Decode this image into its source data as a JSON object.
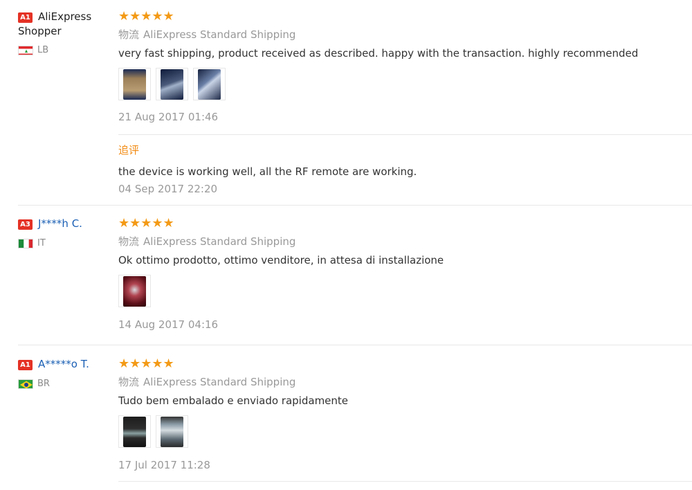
{
  "reviews": [
    {
      "badge": "A1",
      "user": "AliExpress Shopper",
      "user_is_link": false,
      "country": "LB",
      "stars": "★★★★★",
      "shipping_label": "物流",
      "shipping_method": "AliExpress Standard Shipping",
      "text": "very fast shipping, product received as described. happy with the transaction. highly recommended",
      "photos": 3,
      "date": "21 Aug 2017 01:46",
      "followup": {
        "label": "追评",
        "text": "the device is working well, all the RF remote are working.",
        "date": "04 Sep 2017 22:20"
      }
    },
    {
      "badge": "A3",
      "user": "J****h C.",
      "user_is_link": true,
      "country": "IT",
      "stars": "★★★★★",
      "shipping_label": "物流",
      "shipping_method": "AliExpress Standard Shipping",
      "text": "Ok ottimo prodotto, ottimo venditore, in attesa di installazione",
      "photos": 1,
      "date": "14 Aug 2017 04:16"
    },
    {
      "badge": "A1",
      "user": "A*****o T.",
      "user_is_link": true,
      "country": "BR",
      "stars": "★★★★★",
      "shipping_label": "物流",
      "shipping_method": "AliExpress Standard Shipping",
      "text": "Tudo bem embalado e enviado rapidamente",
      "photos": 2,
      "date": "17 Jul 2017 11:28"
    }
  ],
  "colors": {
    "star": "#f39a16",
    "badge": "#e43225",
    "link": "#1a5fb4",
    "followup": "#f28b13"
  }
}
